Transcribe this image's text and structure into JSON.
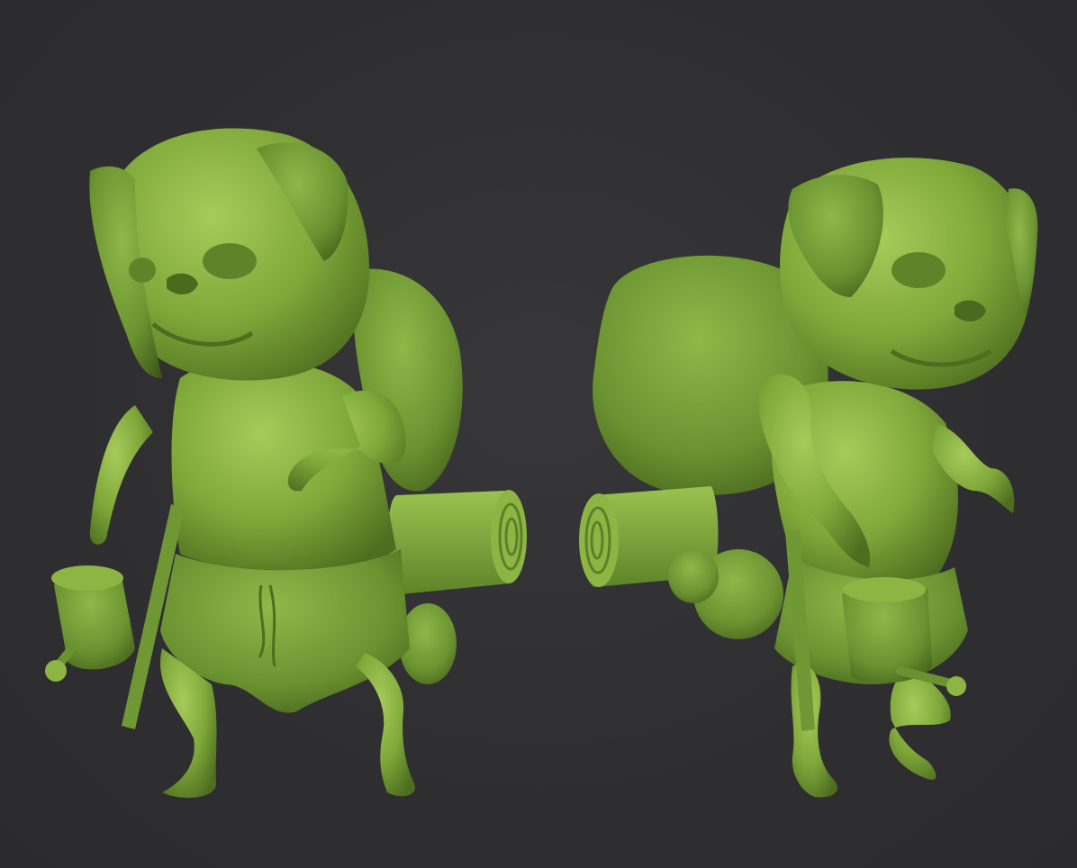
{
  "scene": {
    "background_color": "#2f2f31",
    "clay_color": "#7fa83a",
    "clay_highlight": "#a6cc5a",
    "clay_shadow": "#4e6e1f",
    "subject": "pug-traveler-sculpt",
    "views": [
      "front-three-quarter",
      "side-three-quarter"
    ]
  }
}
